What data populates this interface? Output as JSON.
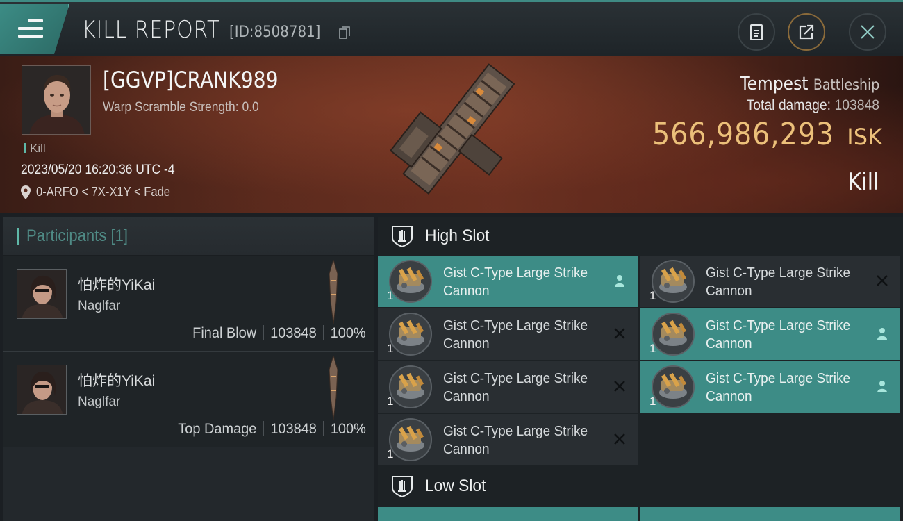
{
  "header": {
    "title": "KILL REPORT",
    "report_id": "[ID:8508781]"
  },
  "victim": {
    "pilot_name": "[GGVP]CRANK989",
    "scramble_text": "Warp Scramble Strength: 0.0",
    "kill_tag": "Kill",
    "timestamp": "2023/05/20 16:20:36 UTC -4",
    "location": "0-ARFO < 7X-X1Y < Fade",
    "ship_name": "Tempest",
    "ship_class": "Battleship",
    "total_damage_label": "Total damage:",
    "total_damage": "103848",
    "isk_value": "566,986,293",
    "isk_unit": "ISK",
    "result": "Kill"
  },
  "participants": {
    "title": "Participants [1]",
    "items": [
      {
        "name": "怕炸的YiKai",
        "ship": "Naglfar",
        "role": "Final Blow",
        "damage": "103848",
        "percent": "100%"
      },
      {
        "name": "怕炸的YiKai",
        "ship": "Naglfar",
        "role": "Top Damage",
        "damage": "103848",
        "percent": "100%"
      }
    ]
  },
  "high_slot": {
    "title": "High Slot",
    "modules": [
      {
        "name": "Gist C-Type Large Strike Cannon",
        "qty": "1",
        "state": "used"
      },
      {
        "name": "Gist C-Type Large Strike Cannon",
        "qty": "1",
        "state": "destroyed"
      },
      {
        "name": "Gist C-Type Large Strike Cannon",
        "qty": "1",
        "state": "destroyed"
      },
      {
        "name": "Gist C-Type Large Strike Cannon",
        "qty": "1",
        "state": "used"
      },
      {
        "name": "Gist C-Type Large Strike Cannon",
        "qty": "1",
        "state": "destroyed"
      },
      {
        "name": "Gist C-Type Large Strike Cannon",
        "qty": "1",
        "state": "used"
      },
      {
        "name": "Gist C-Type Large Strike Cannon",
        "qty": "1",
        "state": "destroyed"
      }
    ]
  },
  "low_slot": {
    "title": "Low Slot"
  },
  "colors": {
    "accent": "#3d8c86",
    "isk": "#ecc07a",
    "panel": "#292e32"
  },
  "icons": [
    "menu-icon",
    "copy-icon",
    "clipboard-icon",
    "share-icon",
    "close-icon",
    "location-pin-icon",
    "slot-shield-icon",
    "user-icon",
    "x-icon"
  ]
}
